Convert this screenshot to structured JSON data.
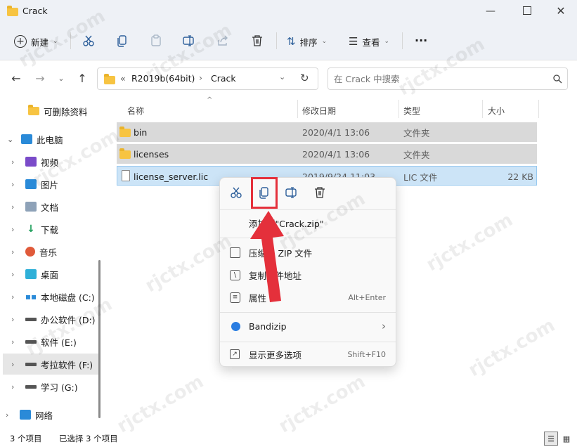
{
  "window": {
    "title": "Crack"
  },
  "toolbar": {
    "new_label": "新建",
    "sort_label": "排序",
    "view_label": "查看",
    "more_label": "···"
  },
  "address": {
    "overflow": "«",
    "crumbs": [
      "R2019b(64bit)",
      "Crack"
    ]
  },
  "search": {
    "placeholder": "在 Crack 中搜索"
  },
  "sidebar": {
    "items": [
      {
        "label": "可删除资料"
      },
      {
        "label": "此电脑"
      },
      {
        "label": "视频"
      },
      {
        "label": "图片"
      },
      {
        "label": "文档"
      },
      {
        "label": "下载"
      },
      {
        "label": "音乐"
      },
      {
        "label": "桌面"
      },
      {
        "label": "本地磁盘 (C:)"
      },
      {
        "label": "办公软件 (D:)"
      },
      {
        "label": "软件 (E:)"
      },
      {
        "label": "考拉软件 (F:)"
      },
      {
        "label": "学习 (G:)"
      },
      {
        "label": "网络"
      }
    ]
  },
  "columns": [
    "名称",
    "修改日期",
    "类型",
    "大小"
  ],
  "files": [
    {
      "name": "bin",
      "date": "2020/4/1 13:06",
      "type": "文件夹",
      "size": ""
    },
    {
      "name": "licenses",
      "date": "2020/4/1 13:06",
      "type": "文件夹",
      "size": ""
    },
    {
      "name": "license_server.lic",
      "date": "2019/9/24 11:03",
      "type": "LIC 文件",
      "size": "22 KB"
    }
  ],
  "context_menu": {
    "items": [
      {
        "label": "添加到\"Crack.zip\"",
        "shortcut": ""
      },
      {
        "label": "压缩为 ZIP 文件",
        "shortcut": ""
      },
      {
        "label": "复制文件地址",
        "shortcut": ""
      },
      {
        "label": "属性",
        "shortcut": "Alt+Enter"
      },
      {
        "label": "Bandizip",
        "shortcut": "›"
      },
      {
        "label": "显示更多选项",
        "shortcut": "Shift+F10"
      }
    ]
  },
  "status": {
    "count": "3 个项目",
    "selected": "已选择 3 个项目"
  },
  "watermark": "rjctx.com",
  "colors": {
    "highlight": "#e4303b",
    "selection": "#cce4f7",
    "selected_gray": "#d9d9d9"
  }
}
